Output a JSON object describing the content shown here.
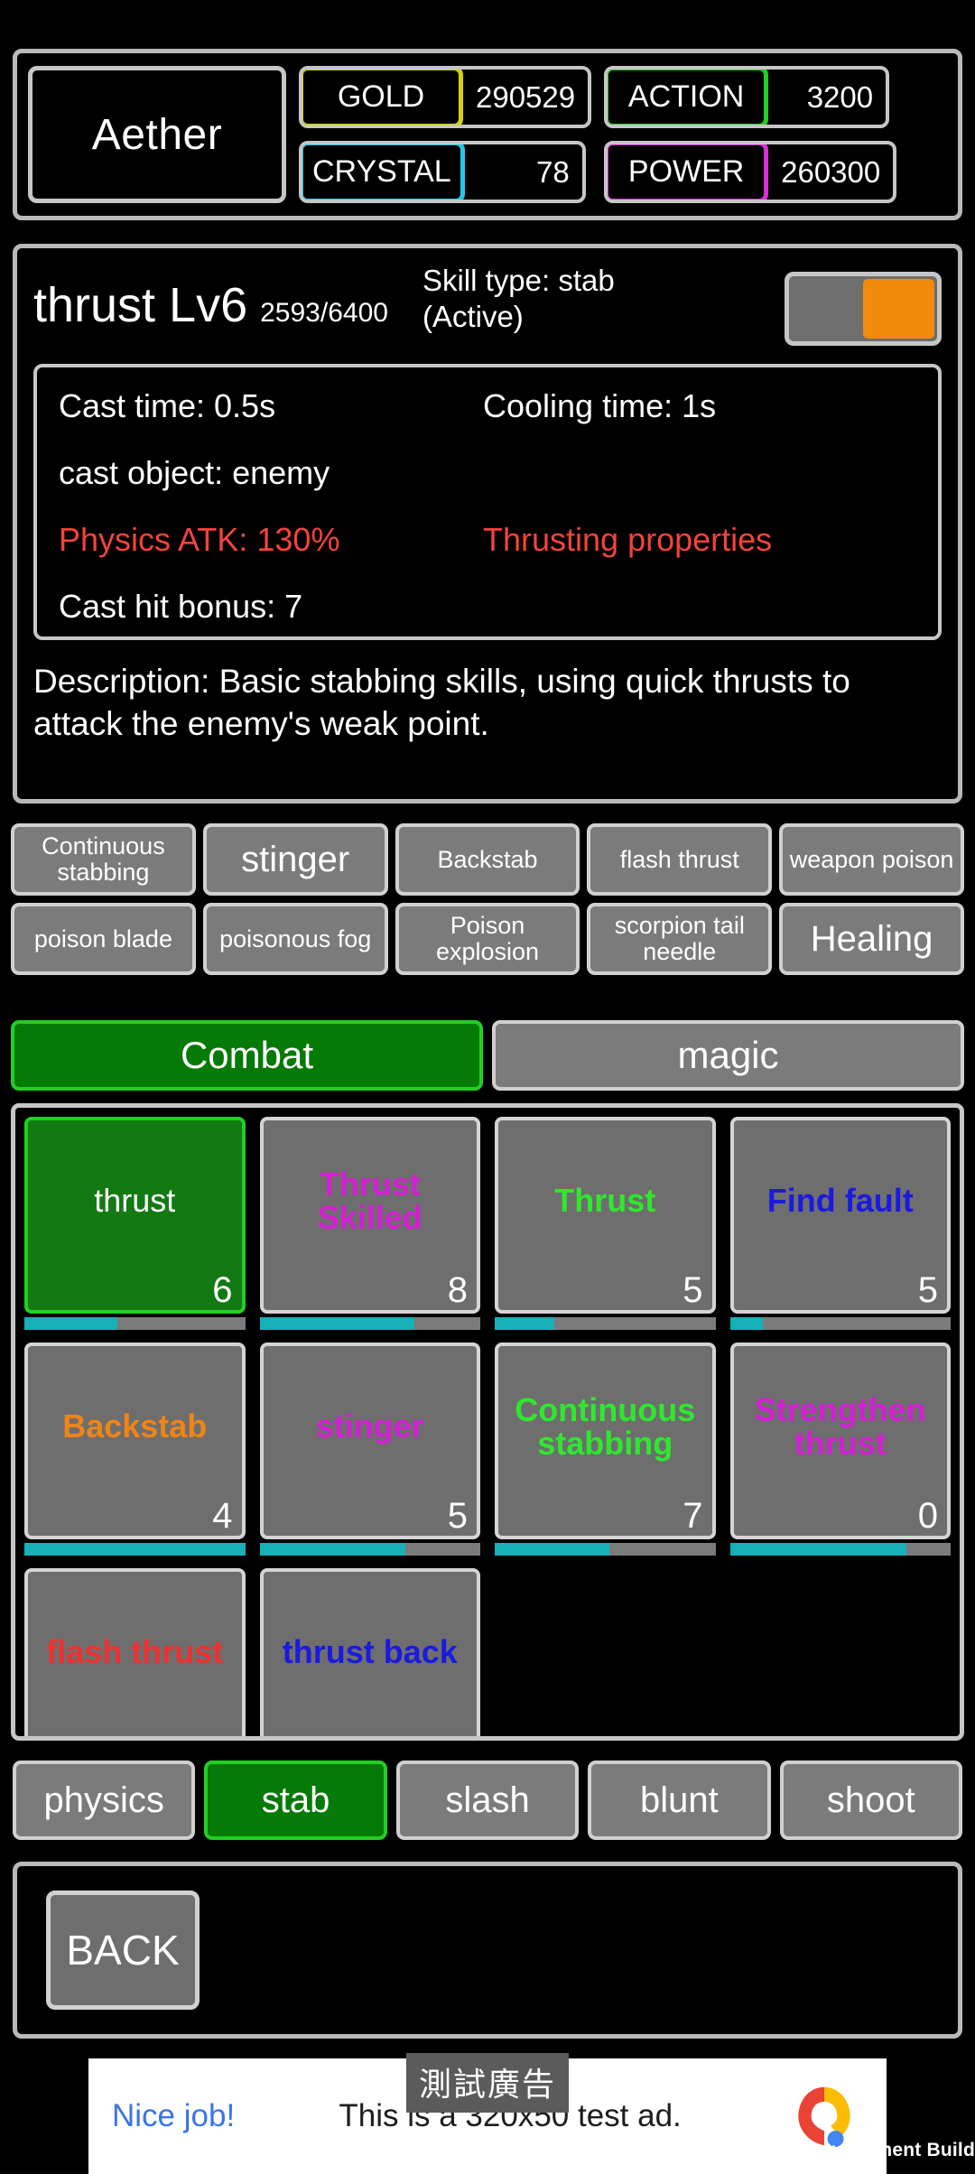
{
  "status_bar": {
    "player_name": "Aether",
    "stats": [
      {
        "label": "GOLD",
        "value": "290529",
        "color": "#d8d000"
      },
      {
        "label": "ACTION",
        "value": "3200",
        "color": "#22cf22"
      },
      {
        "label": "CRYSTAL",
        "value": "78",
        "color": "#22c8e8"
      },
      {
        "label": "POWER",
        "value": "260300",
        "color": "#d830d8"
      }
    ]
  },
  "skill_detail": {
    "title": "thrust Lv6",
    "exp": "2593/6400",
    "skill_type_line1": "Skill type: stab",
    "skill_type_line2": "(Active)",
    "toggle_state": "on",
    "toggle_knob_color": "#f28b0c",
    "cast_time": "Cast time: 0.5s",
    "cooling_time": "Cooling time: 1s",
    "cast_object": "cast object: enemy",
    "physics_atk": "Physics ATK: 130%",
    "properties": "Thrusting properties",
    "cast_hit_bonus": "Cast hit bonus: 7",
    "description": "Description: Basic stabbing skills, using quick thrusts to attack the enemy's weak point.",
    "highlight_color": "#f4433c"
  },
  "chip_rows": {
    "row1": [
      {
        "label": "Continuous stabbing",
        "big": false
      },
      {
        "label": "stinger",
        "big": true
      },
      {
        "label": "Backstab",
        "big": false
      },
      {
        "label": "flash thrust",
        "big": false
      },
      {
        "label": "weapon poison",
        "big": false
      }
    ],
    "row2": [
      {
        "label": "poison blade",
        "big": false
      },
      {
        "label": "poisonous fog",
        "big": false
      },
      {
        "label": "Poison explosion",
        "big": false
      },
      {
        "label": "scorpion tail needle",
        "big": false
      },
      {
        "label": "Healing",
        "big": true
      }
    ]
  },
  "category_tabs": [
    {
      "label": "Combat",
      "active": true
    },
    {
      "label": "magic",
      "active": false
    }
  ],
  "skill_grid": [
    {
      "name": "thrust",
      "level": "6",
      "color": "#ffffff",
      "selected": true,
      "progress": 42
    },
    {
      "name": "Thrust Skilled",
      "level": "8",
      "color": "#d41fd4",
      "selected": false,
      "progress": 70
    },
    {
      "name": "Thrust",
      "level": "5",
      "color": "#2ee82e",
      "selected": false,
      "progress": 27
    },
    {
      "name": "Find fault",
      "level": "5",
      "color": "#1a1ae0",
      "selected": false,
      "progress": 15
    },
    {
      "name": "Backstab",
      "level": "4",
      "color": "#f08416",
      "selected": false,
      "progress": 100
    },
    {
      "name": "stinger",
      "level": "5",
      "color": "#d41fd4",
      "selected": false,
      "progress": 66
    },
    {
      "name": "Continuous stabbing",
      "level": "7",
      "color": "#2ee82e",
      "selected": false,
      "progress": 52
    },
    {
      "name": "Strengthen thrust",
      "level": "0",
      "color": "#d41fd4",
      "selected": false,
      "progress": 80
    },
    {
      "name": "flash thrust",
      "level": "",
      "color": "#f03030",
      "selected": false,
      "progress": 0
    },
    {
      "name": "thrust back",
      "level": "",
      "color": "#1a1ae0",
      "selected": false,
      "progress": 0
    }
  ],
  "filter_chips": [
    {
      "label": "physics",
      "active": false
    },
    {
      "label": "stab",
      "active": true
    },
    {
      "label": "slash",
      "active": false
    },
    {
      "label": "blunt",
      "active": false
    },
    {
      "label": "shoot",
      "active": false
    }
  ],
  "bottom_bar": {
    "back_label": "BACK"
  },
  "ad_banner": {
    "badge": "測試廣告",
    "cta": "Nice job!",
    "text": "This is a 320x50 test ad.",
    "logo": "admob-icon"
  },
  "watermark": "velopment Build"
}
